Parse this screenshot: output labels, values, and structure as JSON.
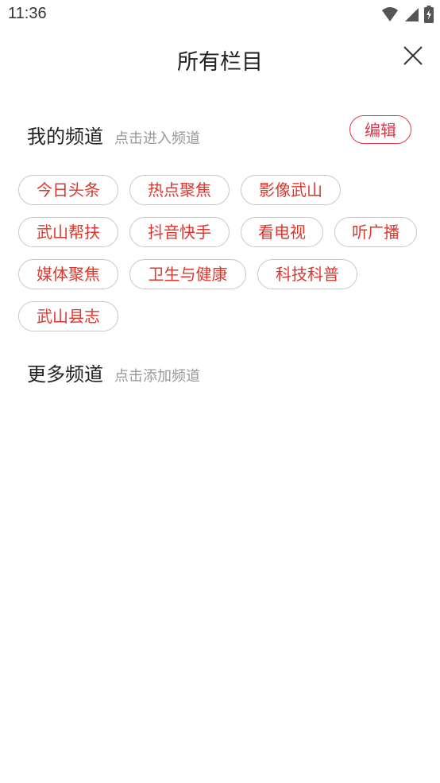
{
  "status_bar": {
    "time": "11:36"
  },
  "header": {
    "title": "所有栏目"
  },
  "my_channels": {
    "title": "我的频道",
    "hint": "点击进入频道",
    "edit_label": "编辑",
    "rows": [
      [
        "今日头条",
        "热点聚焦",
        "影像武山"
      ],
      [
        "武山帮扶",
        "抖音快手",
        "看电视",
        "听广播"
      ],
      [
        "媒体聚焦",
        "卫生与健康",
        "科技科普"
      ],
      [
        "武山县志"
      ]
    ]
  },
  "more_channels": {
    "title": "更多频道",
    "hint": "点击添加频道"
  },
  "colors": {
    "accent": "#e0364c",
    "chip_text": "#e0362c",
    "chip_border": "#c8c8c8"
  }
}
